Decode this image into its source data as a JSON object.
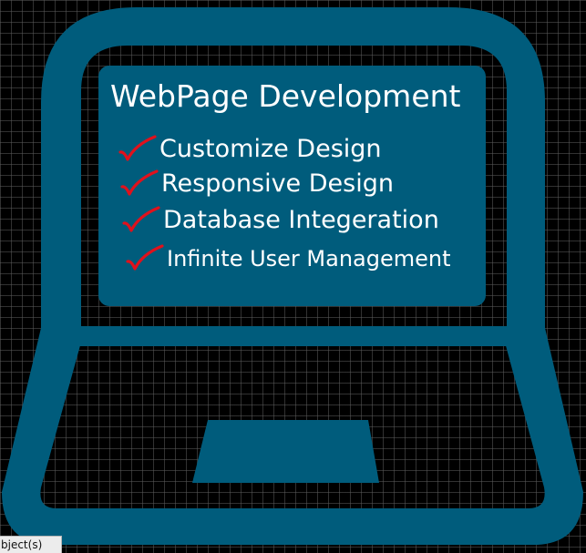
{
  "panel": {
    "title": "WebPage Development",
    "features": [
      {
        "label": "Customize Design",
        "icon": "checkmark-icon"
      },
      {
        "label": "Responsive Design",
        "icon": "checkmark-icon"
      },
      {
        "label": "Database Integeration",
        "icon": "checkmark-icon"
      },
      {
        "label": "Infinite User Management",
        "icon": "checkmark-icon"
      }
    ]
  },
  "status_bar": {
    "text": "bject(s)"
  },
  "colors": {
    "laptop": "#005c7c",
    "background": "#000000",
    "grid": "#5a5a5a",
    "text": "#ffffff",
    "checkmark": "#e0111c"
  }
}
